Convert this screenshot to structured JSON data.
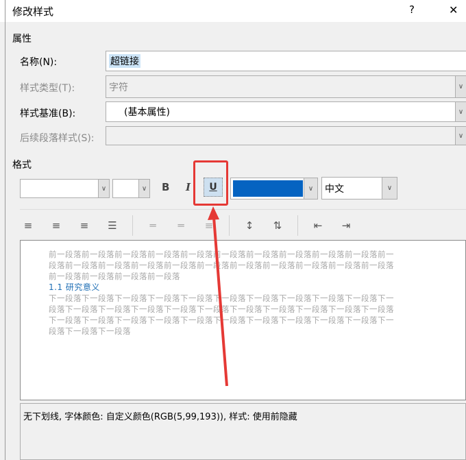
{
  "title": "修改样式",
  "help": "?",
  "close": "✕",
  "properties": {
    "section": "属性",
    "name_label": "名称(N):",
    "name_value": "超链接",
    "type_label": "样式类型(T):",
    "type_value": "字符",
    "based_label": "样式基准(B):",
    "based_value": "(基本属性)",
    "next_label": "后续段落样式(S):",
    "next_value": ""
  },
  "format": {
    "section": "格式",
    "bold": "B",
    "italic": "I",
    "underline": "U",
    "font_color": "#0563c1",
    "script": "中文"
  },
  "preview": {
    "prev_lines": [
      "前一段落前一段落前一段落前一段落前一段落前一段落前一段落前一段落前一段落前一段落前一",
      "段落前一段落前一段落前一段落前一段落前一段落前一段落前一段落前一段落前一段落前一段落",
      "前一段落前一段落前一段落前一段落"
    ],
    "heading": "1.1  研究意义",
    "next_lines": [
      "下一段落下一段落下一段落下一段落下一段落下一段落下一段落下一段落下一段落下一段落下一",
      "段落下一段落下一段落下一段落下一段落下一段落下一段落下一段落下一段落下一段落下一段落",
      "下一段落下一段落下一段落下一段落下一段落下一段落下一段落下一段落下一段落下一段落下一",
      "段落下一段落下一段落"
    ]
  },
  "description": "无下划线, 字体颜色: 自定义颜色(RGB(5,99,193)), 样式: 使用前隐藏",
  "colors": {
    "highlight": "#e53935",
    "selection": "#cce4f7"
  }
}
